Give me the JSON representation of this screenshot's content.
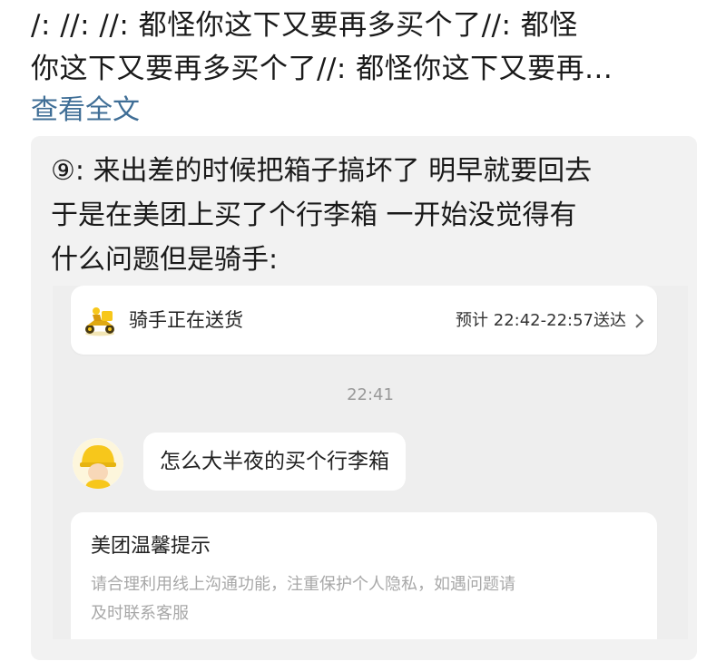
{
  "post": {
    "lines": [
      "/: //: //: 都怪你这下又要再多买个了//: 都怪",
      "你这下又要再多买个了//: 都怪你这下又要再..."
    ],
    "expand_label": "查看全文"
  },
  "repost": {
    "lines": [
      "⑨: 来出差的时候把箱子搞坏了 明早就要回去",
      "于是在美团上买了个行李箱 一开始没觉得有",
      "什么问题但是骑手:"
    ]
  },
  "screenshot": {
    "status_title": "骑手正在送货",
    "eta": "预计 22:42-22:57送达",
    "timestamp": "22:41",
    "message": "怎么大半夜的买个行李箱",
    "notice": {
      "title": "美团温馨提示",
      "body_lines": [
        "请合理利用线上沟通功能，注重保护个人隐私，如遇问题请",
        "及时联系客服"
      ]
    }
  },
  "icons": {
    "rider": "delivery-rider-icon",
    "chevron": "chevron-right-icon",
    "avatar": "rider-avatar"
  },
  "colors": {
    "link": "#3f6e96",
    "repost_bg": "#f2f2f2",
    "meituan_yellow": "#f7c71b"
  }
}
